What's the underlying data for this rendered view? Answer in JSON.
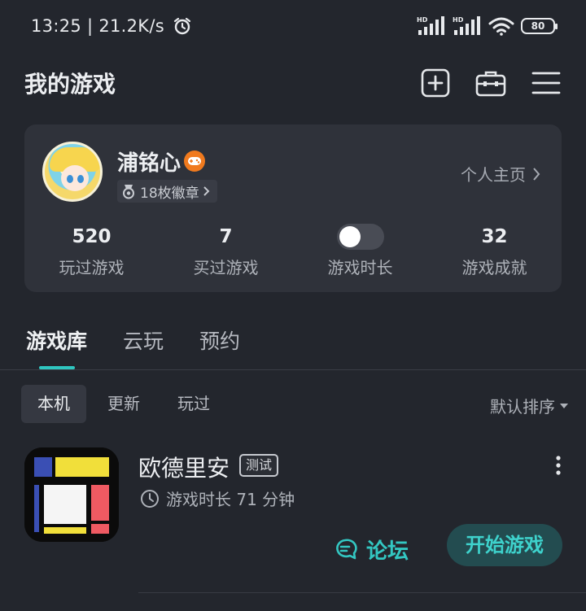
{
  "status_bar": {
    "time_speed": "13:25 | 21.2K/s",
    "battery": "80",
    "signal1_label": "HD",
    "signal2_label": "HD"
  },
  "header": {
    "title": "我的游戏",
    "icons": [
      "add-icon",
      "toolbox-icon",
      "menu-icon"
    ]
  },
  "profile": {
    "username": "浦铭心",
    "medals": "18枚徽章",
    "profile_link": "个人主页",
    "stats": [
      {
        "value": "520",
        "label": "玩过游戏"
      },
      {
        "value": "7",
        "label": "买过游戏"
      },
      {
        "label": "游戏时长",
        "toggle_on": false
      },
      {
        "value": "32",
        "label": "游戏成就"
      }
    ]
  },
  "tabs": [
    "游戏库",
    "云玩",
    "预约"
  ],
  "active_tab": "游戏库",
  "sub_tabs": [
    "本机",
    "更新",
    "玩过"
  ],
  "active_sub_tab": "本机",
  "sort_label": "默认排序",
  "games": [
    {
      "name": "欧德里安",
      "tag": "测试",
      "playtime": "游戏时长 71 分钟",
      "forum_label": "论坛",
      "start_label": "开始游戏"
    }
  ],
  "colors": {
    "background": "#23262d",
    "card": "#2f323a",
    "accent": "#33c7c2",
    "start_button_bg": "#234c50",
    "badge_orange": "#f07a1e"
  }
}
